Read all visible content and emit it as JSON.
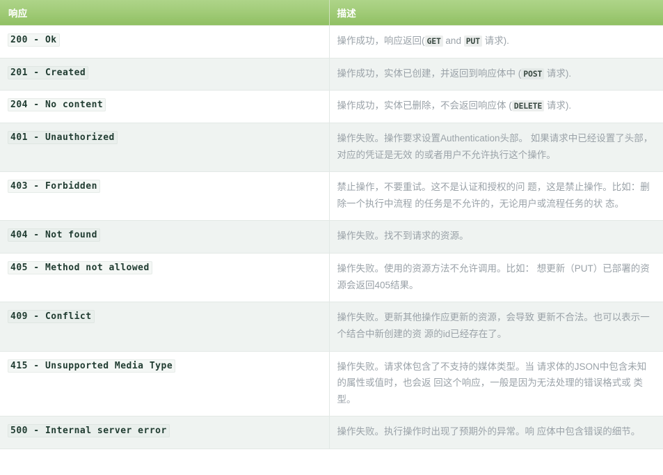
{
  "table": {
    "columns": [
      {
        "key": "response",
        "label": "响应"
      },
      {
        "key": "description",
        "label": "描述"
      }
    ],
    "rows": [
      {
        "code": "200 - Ok",
        "description_parts": [
          {
            "type": "text",
            "text": "操作成功，响应返回("
          },
          {
            "type": "code",
            "text": "GET"
          },
          {
            "type": "text",
            "text": " and "
          },
          {
            "type": "code",
            "text": "PUT"
          },
          {
            "type": "text",
            "text": " 请求)."
          }
        ],
        "description_plain": "操作成功，响应返回(GET and PUT 请求)."
      },
      {
        "code": "201 - Created",
        "description_parts": [
          {
            "type": "text",
            "text": "操作成功，实体已创建，并返回到响应体中 ("
          },
          {
            "type": "code",
            "text": "POST"
          },
          {
            "type": "text",
            "text": " 请求)."
          }
        ],
        "description_plain": "操作成功，实体已创建，并返回到响应体中 (POST 请求)."
      },
      {
        "code": "204 - No content",
        "description_parts": [
          {
            "type": "text",
            "text": "操作成功，实体已删除，不会返回响应体 ("
          },
          {
            "type": "code",
            "text": "DELETE"
          },
          {
            "type": "text",
            "text": " 请求)."
          }
        ],
        "description_plain": "操作成功，实体已删除，不会返回响应体 (DELETE 请求)."
      },
      {
        "code": "401 - Unauthorized",
        "description_parts": [
          {
            "type": "text",
            "text": "操作失败。操作要求设置Authentication头部。 如果请求中已经设置了头部，对应的凭证是无效 的或者用户不允许执行这个操作。"
          }
        ],
        "description_plain": "操作失败。操作要求设置Authentication头部。 如果请求中已经设置了头部，对应的凭证是无效 的或者用户不允许执行这个操作。"
      },
      {
        "code": "403 - Forbidden",
        "description_parts": [
          {
            "type": "text",
            "text": "禁止操作，不要重试。这不是认证和授权的问 题，这是禁止操作。比如：删除一个执行中流程 的任务是不允许的，无论用户或流程任务的状 态。"
          }
        ],
        "description_plain": "禁止操作，不要重试。这不是认证和授权的问 题，这是禁止操作。比如：删除一个执行中流程 的任务是不允许的，无论用户或流程任务的状 态。"
      },
      {
        "code": "404 - Not found",
        "description_parts": [
          {
            "type": "text",
            "text": "操作失败。找不到请求的资源。"
          }
        ],
        "description_plain": "操作失败。找不到请求的资源。"
      },
      {
        "code": "405 - Method not allowed",
        "description_parts": [
          {
            "type": "text",
            "text": "操作失败。使用的资源方法不允许调用。比如： 想更新（PUT）已部署的资源会返回405结果。"
          }
        ],
        "description_plain": "操作失败。使用的资源方法不允许调用。比如： 想更新（PUT）已部署的资源会返回405结果。"
      },
      {
        "code": "409 - Conflict",
        "description_parts": [
          {
            "type": "text",
            "text": "操作失败。更新其他操作应更新的资源，会导致 更新不合法。也可以表示一个结合中新创建的资 源的id已经存在了。"
          }
        ],
        "description_plain": "操作失败。更新其他操作应更新的资源，会导致 更新不合法。也可以表示一个结合中新创建的资 源的id已经存在了。"
      },
      {
        "code": "415 - Unsupported Media Type",
        "description_parts": [
          {
            "type": "text",
            "text": "操作失败。请求体包含了不支持的媒体类型。当 请求体的JSON中包含未知的属性或值时，也会返 回这个响应，一般是因为无法处理的错误格式或 类型。"
          }
        ],
        "description_plain": "操作失败。请求体包含了不支持的媒体类型。当 请求体的JSON中包含未知的属性或值时，也会返 回这个响应，一般是因为无法处理的错误格式或 类型。"
      },
      {
        "code": "500 - Internal server error",
        "description_parts": [
          {
            "type": "text",
            "text": "操作失败。执行操作时出现了预期外的异常。响 应体中包含错误的细节。"
          }
        ],
        "description_plain": "操作失败。执行操作时出现了预期外的异常。响 应体中包含错误的细节。"
      }
    ]
  },
  "colors": {
    "header_gradient_top": "#aed489",
    "header_gradient_bottom": "#90c063",
    "header_text": "#ffffff",
    "row_alt_background": "#eff3f1",
    "row_background": "#ffffff",
    "border": "#e2e8e5",
    "description_text": "#9aa2a8",
    "code_text": "#1f3b30"
  }
}
